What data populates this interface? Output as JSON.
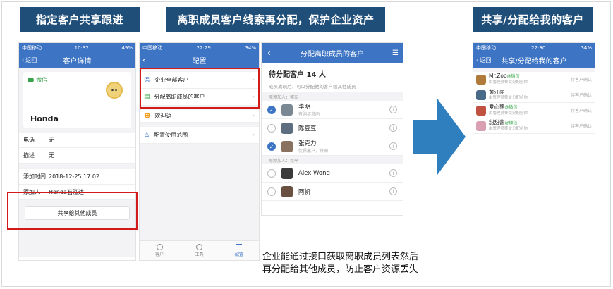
{
  "banners": {
    "left": "指定客户共享跟进",
    "middle": "离职成员客户线索再分配，保护企业资产",
    "right": "共享/分配给我的客户"
  },
  "phone1": {
    "status_left": "中国移动",
    "status_time": "10:32",
    "status_right": "49%",
    "back": "返回",
    "title": "客户详情",
    "wechat_label": "微信",
    "customer_name": "Honda",
    "phone_label": "电话",
    "phone_value": "无",
    "desc_label": "描述",
    "desc_value": "无",
    "added_time_label": "添加时间",
    "added_time_value": "2018-12-25 17:02",
    "added_by_label": "添加人",
    "added_by_value": "Honda石泓达",
    "share_button": "共享给其他成员"
  },
  "phone2": {
    "status_left": "中国移动",
    "status_time": "22:29",
    "status_right": "34%",
    "title": "配置",
    "items": [
      {
        "label": "企业全部客户"
      },
      {
        "label": "分配离职成员的客户"
      },
      {
        "label": "欢迎语"
      },
      {
        "label": "配置使用范围"
      }
    ],
    "tabs": [
      "客户",
      "工具",
      "配置"
    ]
  },
  "phone3": {
    "title": "分配离职成员的客户",
    "pending_title": "待分配客户 14 人",
    "pending_desc": "成员离职后，可以分配他的客户给其他成员",
    "group1_label": "原添加人：郭东",
    "group2_label": "原添加人：叔平",
    "customers": [
      {
        "name": "李明",
        "note": "有购买意向",
        "checked": true
      },
      {
        "name": "陈豆豆",
        "note": "",
        "checked": false
      },
      {
        "name": "张克力",
        "note": "优质客户，铁刷",
        "checked": true
      },
      {
        "name": "Alex Wong",
        "note": "",
        "checked": false
      },
      {
        "name": "阿帆",
        "note": "",
        "checked": false
      }
    ]
  },
  "phone4": {
    "status_left": "中国移动",
    "status_time": "22:30",
    "status_right": "34%",
    "back": "返回",
    "title": "共享/分配给我的客户",
    "customers": [
      {
        "name": "Mr.Zoo",
        "tag": "@微信",
        "sub": "由管理员移交分配给你",
        "action": "待客户确认"
      },
      {
        "name": "黄江丽",
        "tag": "",
        "sub": "由管理员移交分配给你",
        "action": "待客户确认"
      },
      {
        "name": "爱心熊",
        "tag": "@微信",
        "sub": "由管理员移交分配给你",
        "action": "待客户确认"
      },
      {
        "name": "甜甜酱",
        "tag": "@微信",
        "sub": "由管理员移交分配给你",
        "action": "待客户确认"
      }
    ]
  },
  "caption": {
    "line1": "企业能通过接口获取离职成员列表然后",
    "line2": "再分配给其他成员，防止客户资源丢失"
  },
  "colors": {
    "banner": "#1f4e79",
    "nav": "#3d74c4",
    "highlight": "#d21a1a",
    "arrow": "#2f7fbf"
  }
}
